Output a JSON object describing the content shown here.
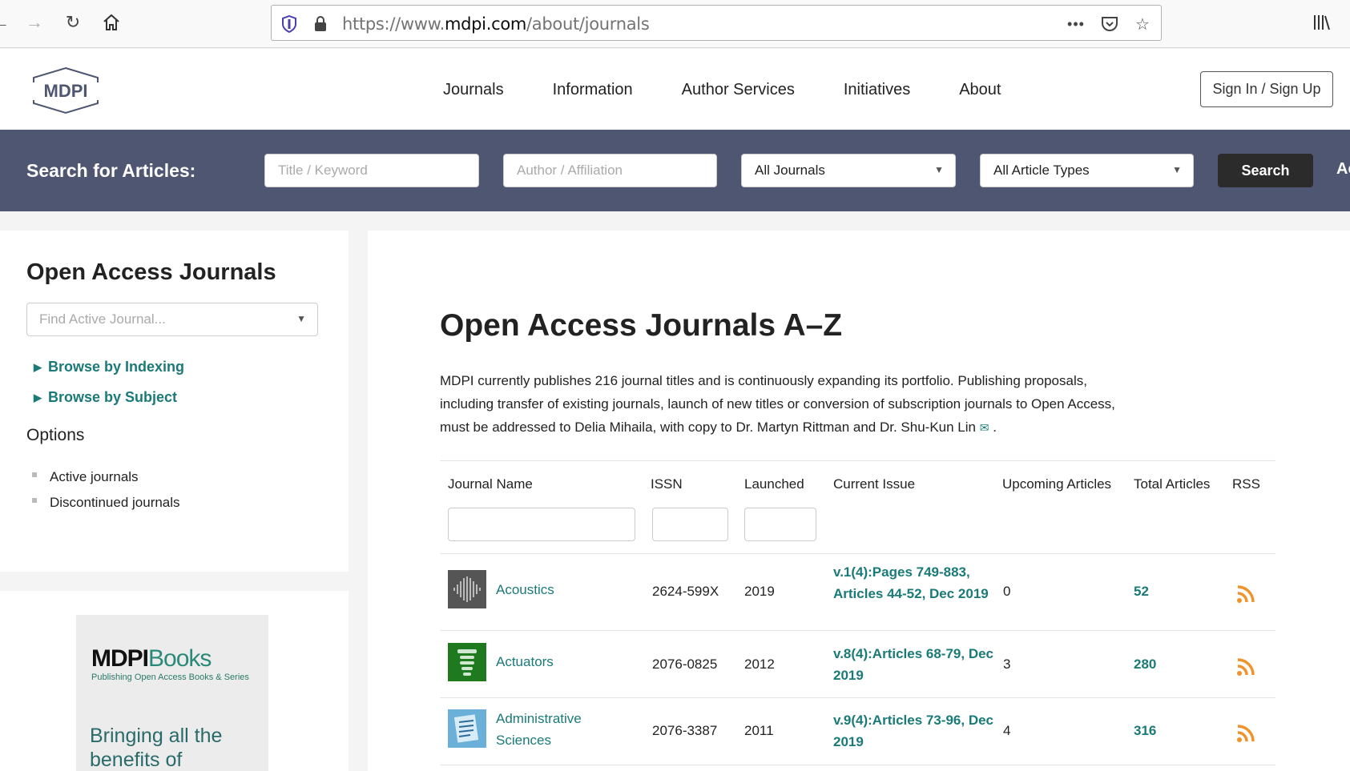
{
  "browser": {
    "url_prefix": "https://www.",
    "url_domain": "mdpi.com",
    "url_path": "/about/journals"
  },
  "header": {
    "logo_text": "MDPI",
    "nav": [
      "Journals",
      "Information",
      "Author Services",
      "Initiatives",
      "About"
    ],
    "sign_in": "Sign In / Sign Up"
  },
  "search": {
    "label": "Search for Articles:",
    "title_placeholder": "Title / Keyword",
    "author_placeholder": "Author / Affiliation",
    "journal_select": "All Journals",
    "type_select": "All Article Types",
    "button": "Search",
    "overflow": "Ac"
  },
  "sidebar": {
    "title": "Open Access Journals",
    "find_placeholder": "Find Active Journal...",
    "browse_indexing": "Browse by Indexing",
    "browse_subject": "Browse by Subject",
    "options_title": "Options",
    "options": [
      "Active journals",
      "Discontinued journals"
    ],
    "ad_brand": "MDPI",
    "ad_brand2": "Books",
    "ad_sub": "Publishing Open Access Books & Series",
    "ad_tagline": "Bringing all the benefits of"
  },
  "main": {
    "title": "Open Access Journals A–Z",
    "intro": "MDPI currently publishes 216 journal titles and is continuously expanding its portfolio. Publishing proposals, including transfer of existing journals, launch of new titles or conversion of subscription journals to Open Access, must be addressed to Delia Mihaila, with copy to Dr. Martyn Rittman and Dr. Shu-Kun Lin",
    "intro_end": ".",
    "mail_icon": "✉",
    "columns": {
      "name": "Journal Name",
      "issn": "ISSN",
      "launched": "Launched",
      "issue": "Current Issue",
      "upcoming": "Upcoming Articles",
      "total": "Total Articles",
      "rss": "RSS"
    },
    "rows": [
      {
        "name": "Acoustics",
        "issn": "2624-599X",
        "launched": "2019",
        "issue": "v.1(4):Pages 749-883, Articles 44-52, Dec 2019",
        "upcoming": "0",
        "total": "52",
        "icon": "acoustics-icon",
        "icon_color": "#555555"
      },
      {
        "name": "Actuators",
        "issn": "2076-0825",
        "launched": "2012",
        "issue": "v.8(4):Articles 68-79, Dec 2019",
        "upcoming": "3",
        "total": "280",
        "icon": "actuators-icon",
        "icon_color": "#1f7a1f"
      },
      {
        "name": "Administrative Sciences",
        "issn": "2076-3387",
        "launched": "2011",
        "issue": "v.9(4):Articles 73-96, Dec 2019",
        "upcoming": "4",
        "total": "316",
        "icon": "administrative-sciences-icon",
        "icon_color": "#6ab0d8"
      }
    ]
  },
  "colors": {
    "accent": "#1a7a78",
    "search_band": "#4f5671",
    "rss": "#f0932b"
  }
}
